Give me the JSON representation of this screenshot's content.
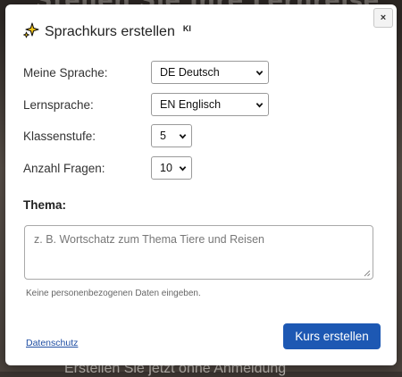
{
  "background": {
    "title_fragment": "Stellen Sie Ihre Lernreise",
    "bottom_fragment": "Erstellen Sie jetzt ohne Anmeldung"
  },
  "dialog": {
    "close_label": "×",
    "title": "Sprachkurs erstellen",
    "title_badge": "KI",
    "title_icon": "sparkle-icon",
    "fields": {
      "native_language": {
        "label": "Meine Sprache:",
        "value": "DE Deutsch"
      },
      "target_language": {
        "label": "Lernsprache:",
        "value": "EN Englisch"
      },
      "grade": {
        "label": "Klassenstufe:",
        "value": "5"
      },
      "question_count": {
        "label": "Anzahl Fragen:",
        "value": "10"
      }
    },
    "topic": {
      "label": "Thema:",
      "placeholder": "z. B. Wortschatz zum Thema Tiere und Reisen"
    },
    "hint": "Keine personenbezogenen Daten eingeben.",
    "privacy_link": "Datenschutz",
    "submit_label": "Kurs erstellen"
  },
  "colors": {
    "accent": "#1d58b3",
    "sparkle": "#e2b300",
    "link": "#1f4ea3"
  }
}
